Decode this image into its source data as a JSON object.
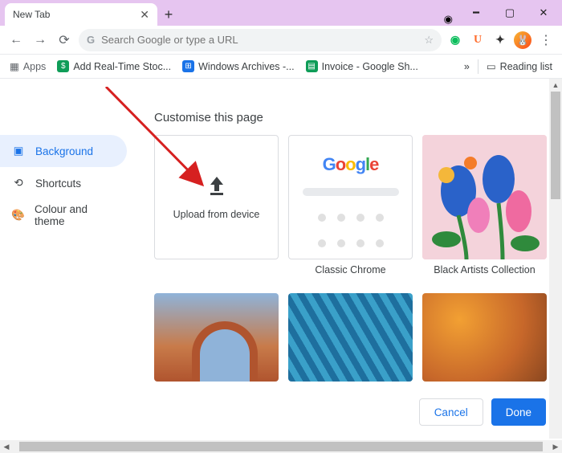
{
  "titlebar": {
    "tab_title": "New Tab"
  },
  "toolbar": {
    "search_placeholder": "Search Google or type a URL"
  },
  "bookmarks": {
    "apps": "Apps",
    "items": [
      {
        "label": "Add Real-Time Stoc...",
        "color": "#0f9d58"
      },
      {
        "label": "Windows Archives -...",
        "color": "#1a73e8"
      },
      {
        "label": "Invoice - Google Sh...",
        "color": "#0f9d58"
      }
    ],
    "overflow": "»",
    "reading_list": "Reading list"
  },
  "dialog": {
    "title": "Customise this page",
    "sidebar": [
      {
        "label": "Background",
        "active": true
      },
      {
        "label": "Shortcuts",
        "active": false
      },
      {
        "label": "Colour and theme",
        "active": false
      }
    ],
    "upload_label": "Upload from device",
    "classic_label": "Classic Chrome",
    "artists_label": "Black Artists Collection",
    "cancel": "Cancel",
    "done": "Done"
  }
}
